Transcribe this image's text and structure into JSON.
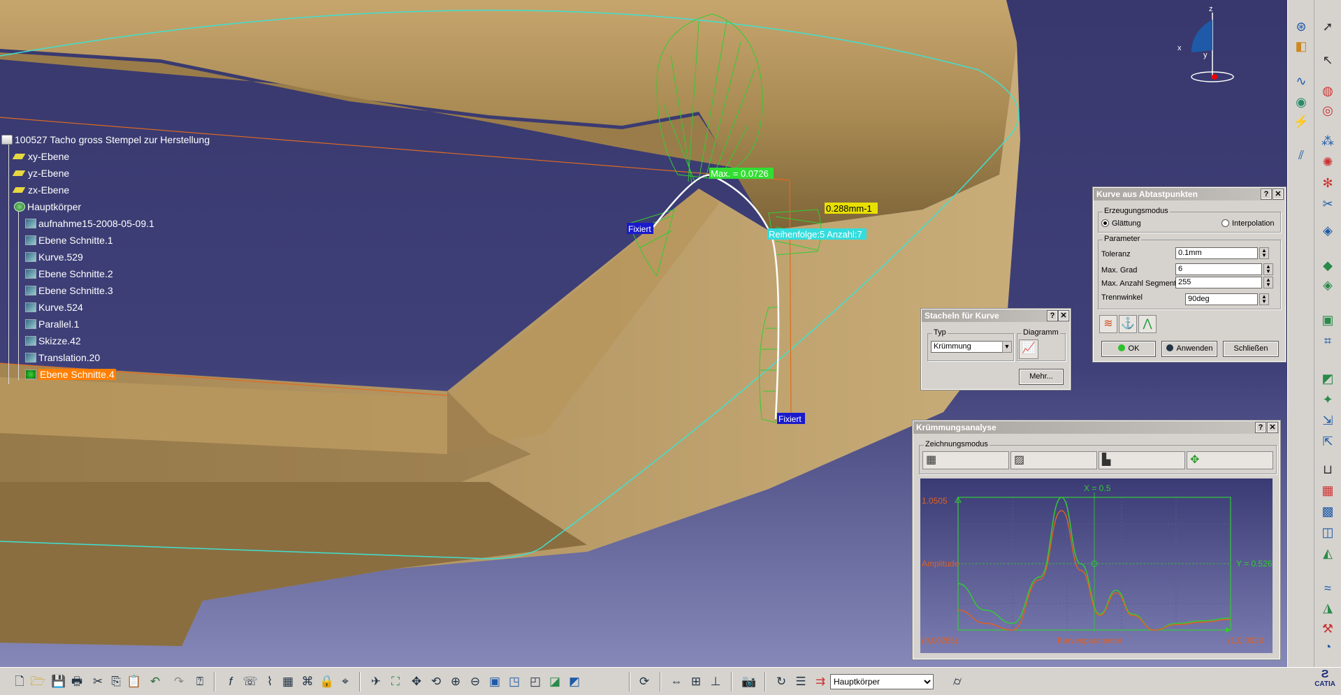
{
  "viewport": {
    "labels": {
      "max": "Max. = 0.0726",
      "curvature": "0.288mm-1",
      "sequence": "Reihenfolge:5 Anzahl:7",
      "fixed_left": "Fixiert",
      "fixed_bottom": "Fixiert"
    },
    "compass": {
      "axis_z": "z",
      "axis_x": "x",
      "axis_y": "y"
    }
  },
  "tree": {
    "root": "100527 Tacho gross Stempel zur Herstellung",
    "items": [
      {
        "label": "xy-Ebene",
        "icon": "plane-icon"
      },
      {
        "label": "yz-Ebene",
        "icon": "plane-icon"
      },
      {
        "label": "zx-Ebene",
        "icon": "plane-icon"
      },
      {
        "label": "Hauptkörper",
        "icon": "body-icon"
      },
      {
        "label": "aufnahme15-2008-05-09.1",
        "icon": "cloud-icon"
      },
      {
        "label": "Ebene Schnitte.1",
        "icon": "planar-sections-icon"
      },
      {
        "label": "Kurve.529",
        "icon": "curve-icon"
      },
      {
        "label": "Ebene Schnitte.2",
        "icon": "planar-sections-icon"
      },
      {
        "label": "Ebene Schnitte.3",
        "icon": "planar-sections-icon"
      },
      {
        "label": "Kurve.524",
        "icon": "curve-icon"
      },
      {
        "label": "Parallel.1",
        "icon": "parallel-icon"
      },
      {
        "label": "Skizze.42",
        "icon": "sketch-icon"
      },
      {
        "label": "Translation.20",
        "icon": "translation-icon"
      },
      {
        "label": "Ebene Schnitte.4",
        "icon": "planar-sections-icon",
        "selected": true
      }
    ]
  },
  "dialog_kurve": {
    "title": "Kurve aus Abtastpunkten",
    "mode_group": "Erzeugungsmodus",
    "mode_smooth": "Glättung",
    "mode_interp": "Interpolation",
    "param_group": "Parameter",
    "tolerance_label": "Toleranz",
    "tolerance_value": "0.1mm",
    "max_degree_label": "Max. Grad",
    "max_degree_value": "6",
    "max_segments_label": "Max. Anzahl Segmente",
    "max_segments_value": "255",
    "angle_label": "Trennwinkel",
    "angle_value": "90deg",
    "ok": "OK",
    "apply": "Anwenden",
    "close": "Schließen"
  },
  "dialog_stacheln": {
    "title": "Stacheln für Kurve",
    "type_group": "Typ",
    "type_value": "Krümmung",
    "diagram_group": "Diagramm",
    "more": "Mehr..."
  },
  "dialog_analyse": {
    "title": "Krümmungsanalyse",
    "mode_group": "Zeichnungsmodus",
    "plot": {
      "x_label": "X = 0.5",
      "y_label": "Y = 0.526",
      "amplitude": "Amplitude",
      "max_label": "1.0505",
      "min_label": "(0,00285)",
      "x_axis": "Kurvenparameter",
      "end_label": "(1,0,0028"
    }
  },
  "chart_data": {
    "type": "line",
    "title": "",
    "xlabel": "Kurvenparameter",
    "ylabel": "Amplitude",
    "xlim": [
      0,
      1
    ],
    "series": [
      {
        "name": "",
        "color": "#33cc33",
        "x": [
          0,
          0.1,
          0.2,
          0.3,
          0.38,
          0.45,
          0.52,
          0.58,
          0.64,
          0.72,
          0.8,
          0.9,
          1.0
        ],
        "y": [
          0.35,
          0.15,
          0.05,
          0.4,
          1.0,
          0.5,
          0.12,
          0.3,
          0.12,
          0.0,
          0.05,
          0.07,
          0.09
        ]
      },
      {
        "name": "",
        "color": "#e06020",
        "x": [
          0,
          0.1,
          0.2,
          0.3,
          0.38,
          0.45,
          0.52,
          0.58,
          0.64,
          0.72,
          0.8,
          0.9,
          1.0
        ],
        "y": [
          0.15,
          0.05,
          0.0,
          0.38,
          0.9,
          0.45,
          0.11,
          0.28,
          0.11,
          0.0,
          0.04,
          0.06,
          0.08
        ]
      }
    ]
  },
  "bottom_toolbar": {
    "body_select": "Hauptkörper"
  },
  "brand": {
    "logo": "CATIA",
    "accent": "#33cc33",
    "selection": "#ff7f00"
  }
}
